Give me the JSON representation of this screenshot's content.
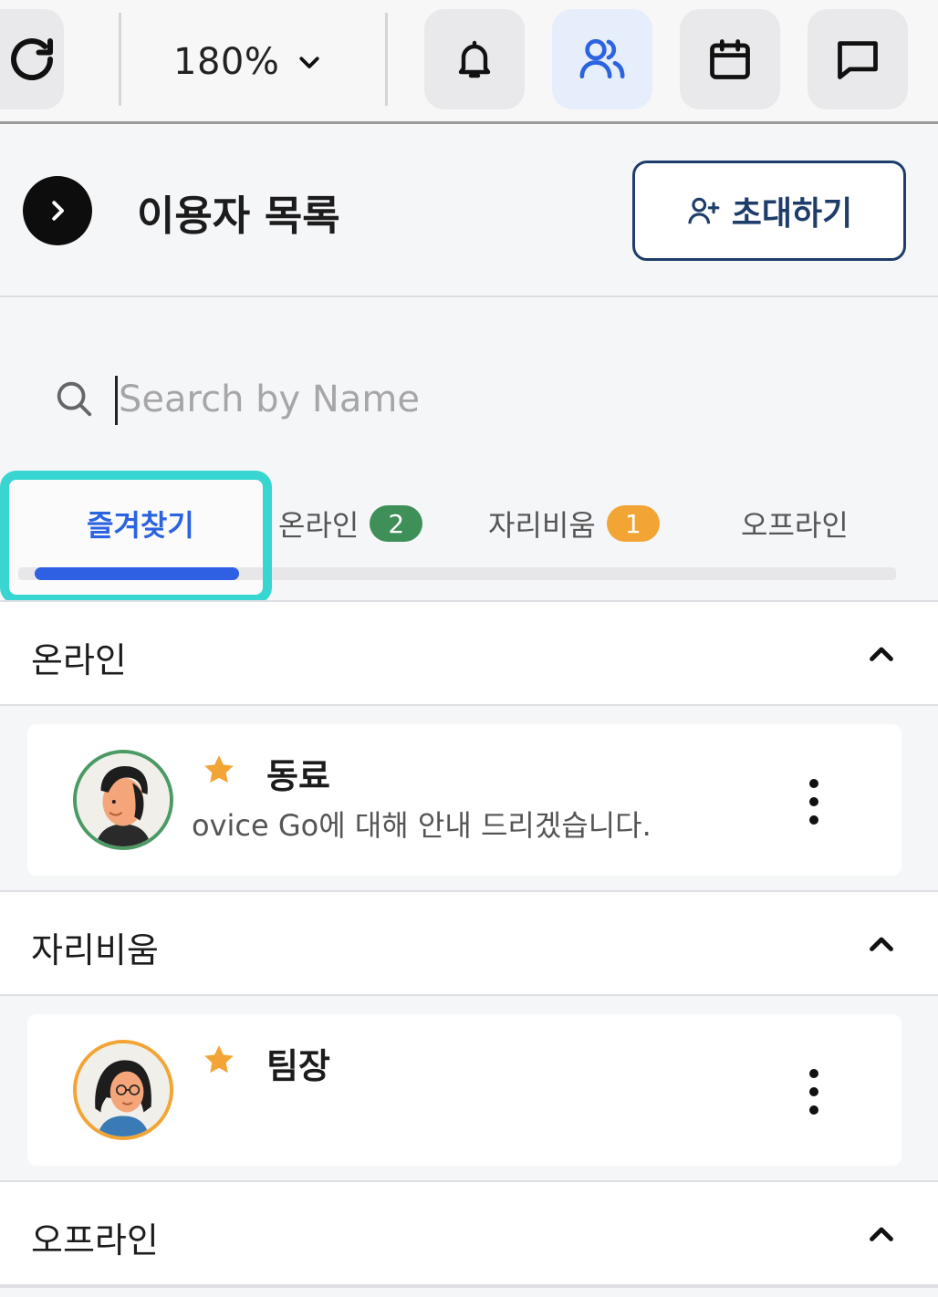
{
  "toolbar": {
    "zoom_label": "180%",
    "icons": [
      "refresh-icon",
      "chevron-down-icon",
      "bell-icon",
      "users-icon",
      "calendar-icon",
      "chat-icon"
    ],
    "active": "users-icon"
  },
  "header": {
    "title": "이용자 목록",
    "invite_label": "초대하기"
  },
  "search": {
    "placeholder": "Search by Name",
    "value": ""
  },
  "tabs": [
    {
      "label": "즐겨찾기",
      "active": true
    },
    {
      "label": "온라인",
      "count": "2"
    },
    {
      "label": "자리비움",
      "count": "1"
    },
    {
      "label": "오프라인"
    }
  ],
  "sections": {
    "online": {
      "title": "온라인",
      "users": [
        {
          "name": "동료",
          "status": "ovice Go에 대해 안내 드리겠습니다.",
          "favorite": true
        }
      ]
    },
    "away": {
      "title": "자리비움",
      "users": [
        {
          "name": "팀장",
          "status": "",
          "favorite": true
        }
      ]
    },
    "offline": {
      "title": "오프라인"
    }
  },
  "colors": {
    "accent_blue": "#2f5fe3",
    "online_green": "#3f8f59",
    "away_orange": "#f2a535",
    "highlight_cyan": "#38d5d1",
    "invite_navy": "#1e3d6b",
    "star": "#f2a535"
  }
}
